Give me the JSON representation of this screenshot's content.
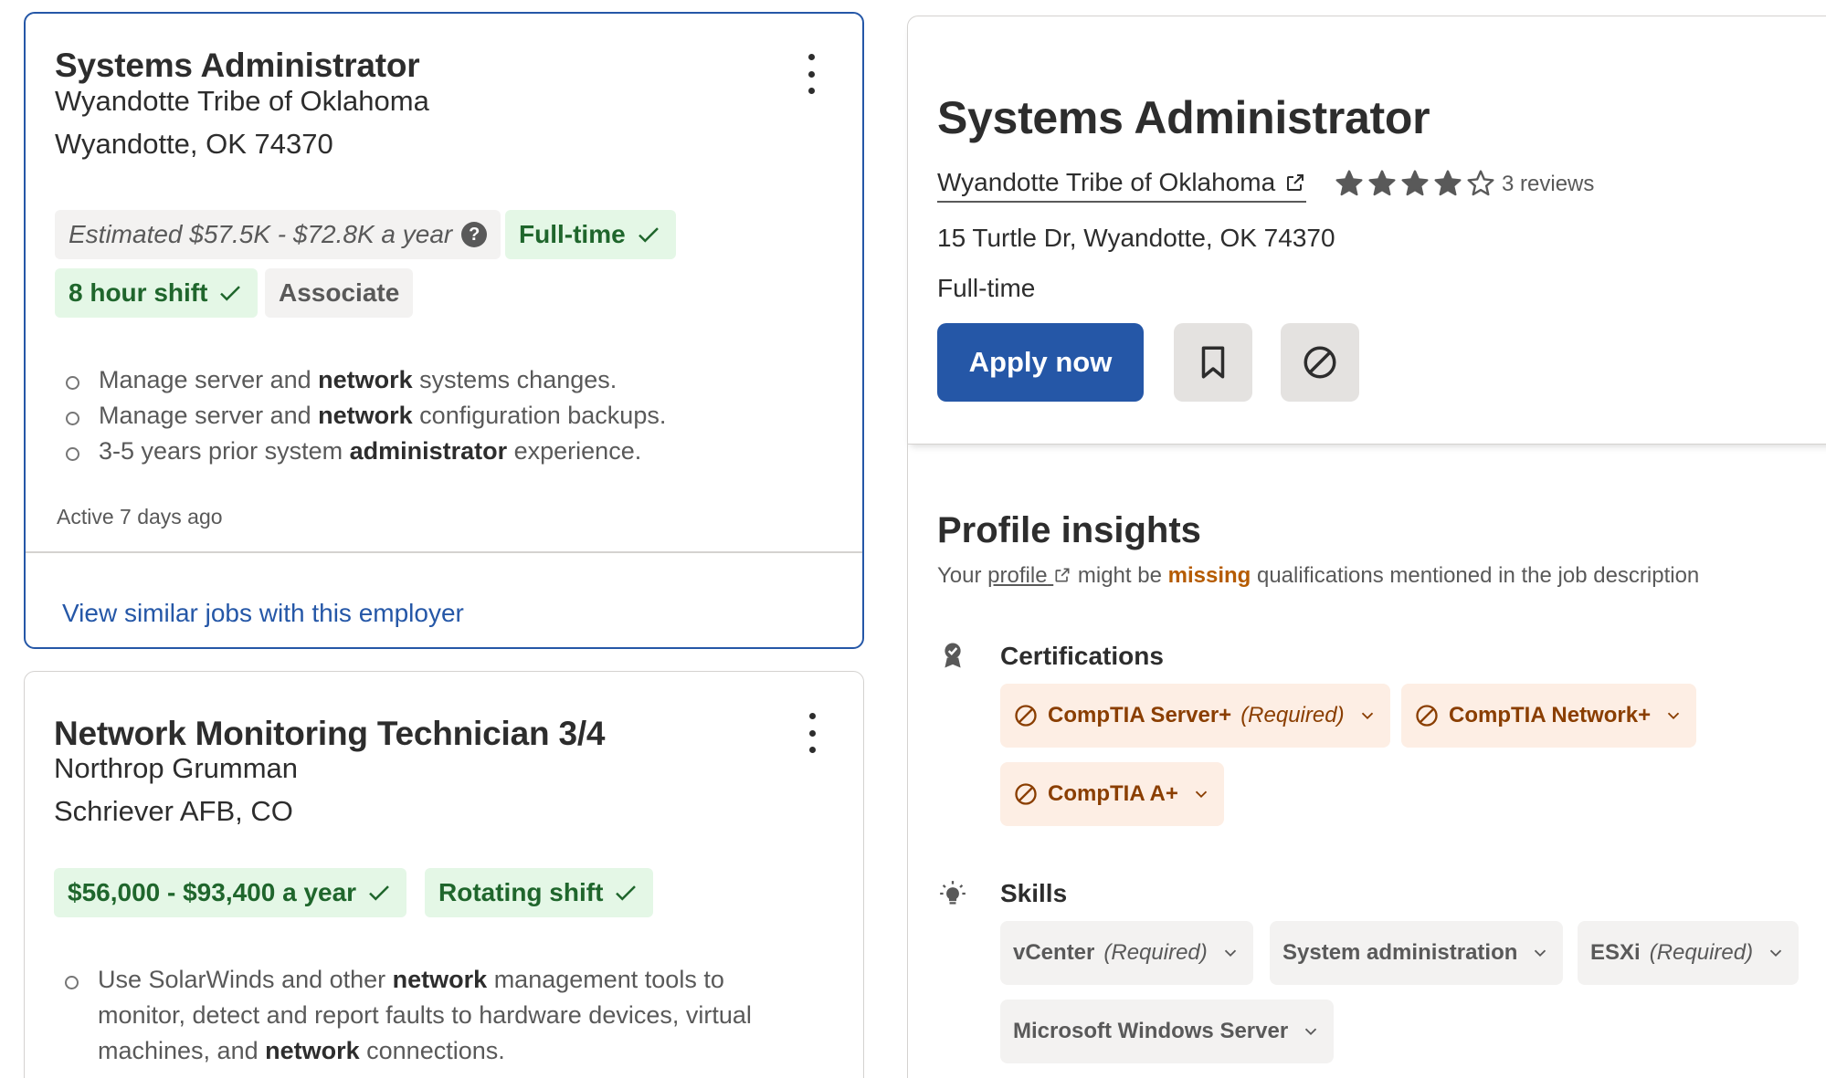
{
  "job_list": [
    {
      "title": "Systems Administrator",
      "company": "Wyandotte Tribe of Oklahoma",
      "location": "Wyandotte, OK 74370",
      "salary_estimate": "Estimated $57.5K - $72.8K a year",
      "help_glyph": "?",
      "tags": [
        "Full-time",
        "8 hour shift",
        "Associate"
      ],
      "bullets": [
        {
          "pre": "Manage server and ",
          "bold": "network",
          "post": " systems changes."
        },
        {
          "pre": "Manage server and ",
          "bold": "network",
          "post": " configuration backups."
        },
        {
          "pre": "3-5 years prior system ",
          "bold": "administrator",
          "post": " experience."
        }
      ],
      "active": "Active 7 days ago",
      "similar_link": "View similar jobs with this employer"
    },
    {
      "title": "Network Monitoring Technician 3/4",
      "company": "Northrop Grumman",
      "location": "Schriever AFB, CO",
      "tags": [
        "$56,000 - $93,400 a year",
        "Rotating shift"
      ],
      "bullet": {
        "pre": "Use SolarWinds and other ",
        "bold1": "network",
        "mid1": " management tools to",
        "line2": "monitor, detect and report faults to hardware devices, virtual",
        "line3_pre": "machines, and ",
        "bold2": "network",
        "line3_post": " connections."
      }
    }
  ],
  "detail": {
    "title": "Systems Administrator",
    "company": "Wyandotte Tribe of Oklahoma",
    "rating": 4,
    "rating_max": 5,
    "reviews": "3 reviews",
    "address": "15 Turtle Dr, Wyandotte, OK 74370",
    "job_type": "Full-time",
    "apply_label": "Apply now"
  },
  "insights": {
    "title": "Profile insights",
    "sub_pre": "Your ",
    "sub_link": "profile",
    "sub_mid": " might be ",
    "sub_missing": "missing",
    "sub_post": " qualifications mentioned in the job description",
    "certifications_label": "Certifications",
    "certifications": [
      {
        "name": "CompTIA Server+",
        "req": "(Required)"
      },
      {
        "name": "CompTIA Network+",
        "req": ""
      },
      {
        "name": "CompTIA A+",
        "req": ""
      }
    ],
    "skills_label": "Skills",
    "skills": [
      {
        "name": "vCenter",
        "req": "(Required)"
      },
      {
        "name": "System administration",
        "req": ""
      },
      {
        "name": "ESXi",
        "req": "(Required)"
      },
      {
        "name": "Microsoft Windows Server",
        "req": ""
      }
    ]
  },
  "colors": {
    "brand_blue": "#2557a7",
    "green_tag_bg": "#e4f7e6",
    "green_tag_text": "#1f662c",
    "missing_orange": "#b55b00",
    "cert_tag_bg": "#fdeee4"
  },
  "icons": [
    "more-vertical-icon",
    "help-icon",
    "check-icon",
    "external-link-icon",
    "star-icon",
    "bookmark-icon",
    "not-interested-icon",
    "certification-icon",
    "skills-lightbulb-icon",
    "chevron-down-icon",
    "prohibited-icon"
  ]
}
